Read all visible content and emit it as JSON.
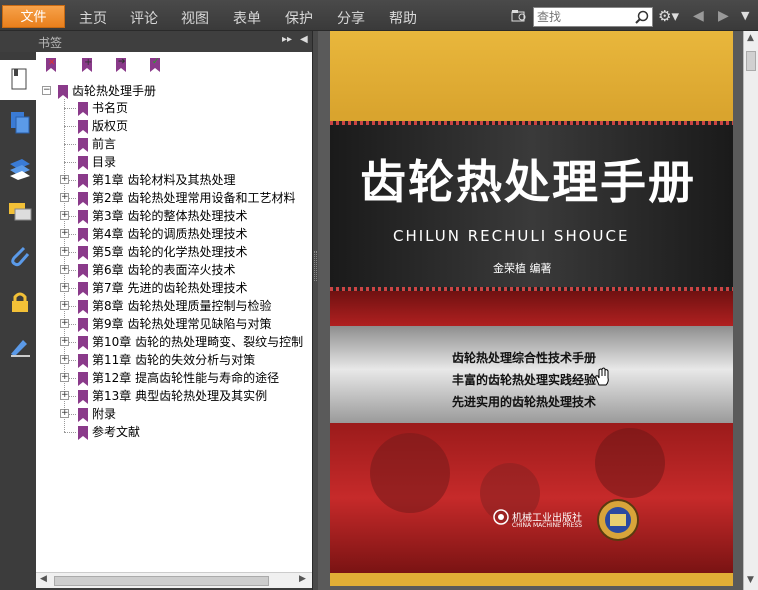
{
  "menubar": {
    "file": "文件",
    "items": [
      "主页",
      "评论",
      "视图",
      "表单",
      "保护",
      "分享",
      "帮助"
    ],
    "search_placeholder": "查找"
  },
  "panel": {
    "title": "书签"
  },
  "tree": {
    "root": "齿轮热处理手册",
    "children": [
      {
        "label": "书名页",
        "expandable": false
      },
      {
        "label": "版权页",
        "expandable": false
      },
      {
        "label": "前言",
        "expandable": false
      },
      {
        "label": "目录",
        "expandable": false
      },
      {
        "label": "第1章  齿轮材料及其热处理",
        "expandable": true
      },
      {
        "label": "第2章  齿轮热处理常用设备和工艺材料",
        "expandable": true
      },
      {
        "label": "第3章  齿轮的整体热处理技术",
        "expandable": true
      },
      {
        "label": "第4章  齿轮的调质热处理技术",
        "expandable": true
      },
      {
        "label": "第5章  齿轮的化学热处理技术",
        "expandable": true
      },
      {
        "label": "第6章  齿轮的表面淬火技术",
        "expandable": true
      },
      {
        "label": "第7章  先进的齿轮热处理技术",
        "expandable": true
      },
      {
        "label": "第8章  齿轮热处理质量控制与检验",
        "expandable": true
      },
      {
        "label": "第9章  齿轮热处理常见缺陷与对策",
        "expandable": true
      },
      {
        "label": "第10章  齿轮的热处理畸变、裂纹与控制",
        "expandable": true
      },
      {
        "label": "第11章  齿轮的失效分析与对策",
        "expandable": true
      },
      {
        "label": "第12章  提高齿轮性能与寿命的途径",
        "expandable": true
      },
      {
        "label": "第13章  典型齿轮热处理及其实例",
        "expandable": true
      },
      {
        "label": "附录",
        "expandable": true
      },
      {
        "label": "参考文献",
        "expandable": false
      }
    ]
  },
  "cover": {
    "title": "齿轮热处理手册",
    "pinyin": "CHILUN RECHULI SHOUCE",
    "author": "金荣植  编著",
    "taglines": [
      "齿轮热处理综合性技术手册",
      "丰富的齿轮热处理实践经验",
      "先进实用的齿轮热处理技术"
    ],
    "publisher_cn": "机械工业出版社",
    "publisher_en": "CHINA MACHINE PRESS"
  },
  "colors": {
    "accent": "#e97f1c",
    "bookmark": "#8a3a8a",
    "cover_gold": "#e1ae36",
    "cover_red": "#c62a2a"
  }
}
